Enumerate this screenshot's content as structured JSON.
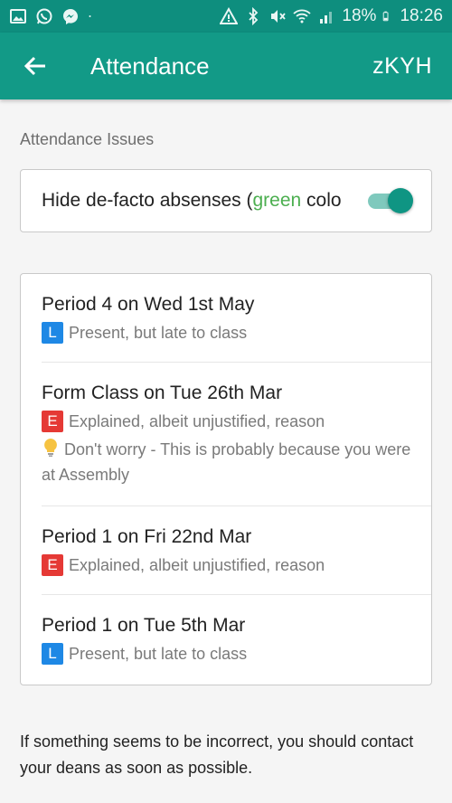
{
  "status_bar": {
    "battery": "18%",
    "time": "18:26",
    "icons": [
      "gallery-icon",
      "whatsapp-icon",
      "messenger-icon",
      "dot-icon",
      "warning-icon",
      "bluetooth-icon",
      "mute-icon",
      "wifi-icon",
      "signal-icon",
      "battery-icon"
    ]
  },
  "app_bar": {
    "title": "Attendance",
    "action": "zKYH"
  },
  "section_heading": "Attendance Issues",
  "toggle": {
    "label_prefix": "Hide de-facto absenses (",
    "label_green": "green",
    "label_suffix": " colo",
    "on": true
  },
  "items": [
    {
      "title": "Period 4 on Wed 1st May",
      "code": "L",
      "code_color": "#1e88e5",
      "reason": "Present, but late to class"
    },
    {
      "title": "Form Class on Tue 26th Mar",
      "code": "E",
      "code_color": "#e53935",
      "reason": "Explained, albeit unjustified, reason",
      "note": "Don't worry - This is probably because you were at Assembly"
    },
    {
      "title": "Period 1 on Fri 22nd Mar",
      "code": "E",
      "code_color": "#e53935",
      "reason": "Explained, albeit unjustified, reason"
    },
    {
      "title": "Period 1 on Tue 5th Mar",
      "code": "L",
      "code_color": "#1e88e5",
      "reason": "Present, but late to class"
    }
  ],
  "footer": "If something seems to be incorrect, you should contact your deans as soon as possible.",
  "colors": {
    "primary": "#129a87",
    "status_bar": "#0e8e7e",
    "green_text": "#4caf50"
  }
}
